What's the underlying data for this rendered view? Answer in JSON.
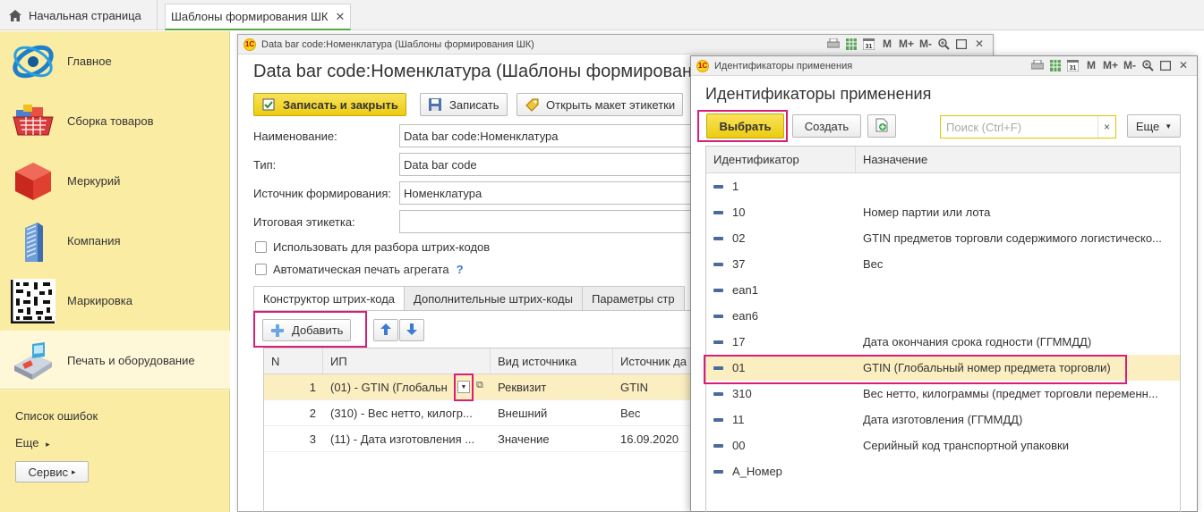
{
  "top_tabs": {
    "home_label": "Начальная страница",
    "active_label": "Шаблоны формирования ШК",
    "close_glyph": "✕"
  },
  "sidebar": {
    "items": [
      {
        "label": "Главное",
        "icon": "main-section-icon"
      },
      {
        "label": "Сборка товаров",
        "icon": "basket-icon"
      },
      {
        "label": "Меркурий",
        "icon": "red-cube-icon"
      },
      {
        "label": "Компания",
        "icon": "building-icon"
      },
      {
        "label": "Маркировка",
        "icon": "datamatrix-icon"
      },
      {
        "label": "Печать и оборудование",
        "icon": "cash-register-icon"
      }
    ],
    "errors_link": "Список ошибок",
    "more_link": "Еще",
    "service_button": "Сервис"
  },
  "window1": {
    "title": "Data bar code:Номенклатура (Шаблоны формирования ШК)",
    "heading": "Data bar code:Номенклатура (Шаблоны формирования ШК)",
    "toolbar": {
      "save_close": "Записать и закрыть",
      "save": "Записать",
      "open_layout": "Открыть макет этикетки"
    },
    "fields": {
      "name_label": "Наименование:",
      "name_value": "Data bar code:Номенклатура",
      "type_label": "Тип:",
      "type_value": "Data bar code",
      "source_label": "Источник формирования:",
      "source_value": "Номенклатура",
      "final_label_label": "Итоговая этикетка:",
      "final_label_value": ""
    },
    "checkboxes": {
      "use_parsing": "Использовать для разбора штрих-кодов",
      "auto_print": "Автоматическая печать агрегата",
      "help_glyph": "?"
    },
    "tabs": [
      "Конструктор штрих-кода",
      "Дополнительные штрих-коды",
      "Параметры стр"
    ],
    "add_button": "Добавить",
    "grid": {
      "columns": [
        "N",
        "ИП",
        "Вид источника",
        "Источник да"
      ],
      "rows": [
        {
          "n": "1",
          "ip": "(01) - GTIN (Глобальн",
          "kind": "Реквизит",
          "source": "GTIN"
        },
        {
          "n": "2",
          "ip": "(310) - Вес нетто, килогр...",
          "kind": "Внешний",
          "source": "Вес"
        },
        {
          "n": "3",
          "ip": "(11) - Дата изготовления ...",
          "kind": "Значение",
          "source": "16.09.2020"
        }
      ]
    }
  },
  "window2": {
    "title": "Идентификаторы применения",
    "heading": "Идентификаторы применения",
    "select_button": "Выбрать",
    "create_button": "Создать",
    "search_placeholder": "Поиск (Ctrl+F)",
    "search_clear": "×",
    "more_button": "Еще",
    "grid": {
      "columns": [
        "Идентификатор",
        "Назначение"
      ],
      "rows": [
        {
          "id": "1",
          "purpose": ""
        },
        {
          "id": "10",
          "purpose": "Номер партии или лота"
        },
        {
          "id": "02",
          "purpose": "GTIN предметов торговли содержимого логистическо..."
        },
        {
          "id": "37",
          "purpose": "Вес"
        },
        {
          "id": "ean1",
          "purpose": ""
        },
        {
          "id": "ean6",
          "purpose": ""
        },
        {
          "id": "17",
          "purpose": "Дата окончания срока годности (ГГММДД)"
        },
        {
          "id": "01",
          "purpose": "GTIN (Глобальный номер предмета торговли)"
        },
        {
          "id": "310",
          "purpose": "Вес нетто, килограммы (предмет торговли переменн..."
        },
        {
          "id": "11",
          "purpose": "Дата изготовления (ГГММДД)"
        },
        {
          "id": "00",
          "purpose": "Серийный код транспортной упаковки"
        },
        {
          "id": "A_Номер",
          "purpose": ""
        }
      ]
    }
  },
  "window_toolbar_glyphs": {
    "m": "M",
    "m_plus": "M+",
    "m_minus": "M-",
    "close": "✕"
  },
  "colors": {
    "sidebar_bg": "#fbeca4",
    "accent_yellow": "#f2d82e",
    "selection_row": "#fbeec0",
    "highlight_frame": "#d81e77",
    "tab_underline": "#58a742"
  }
}
